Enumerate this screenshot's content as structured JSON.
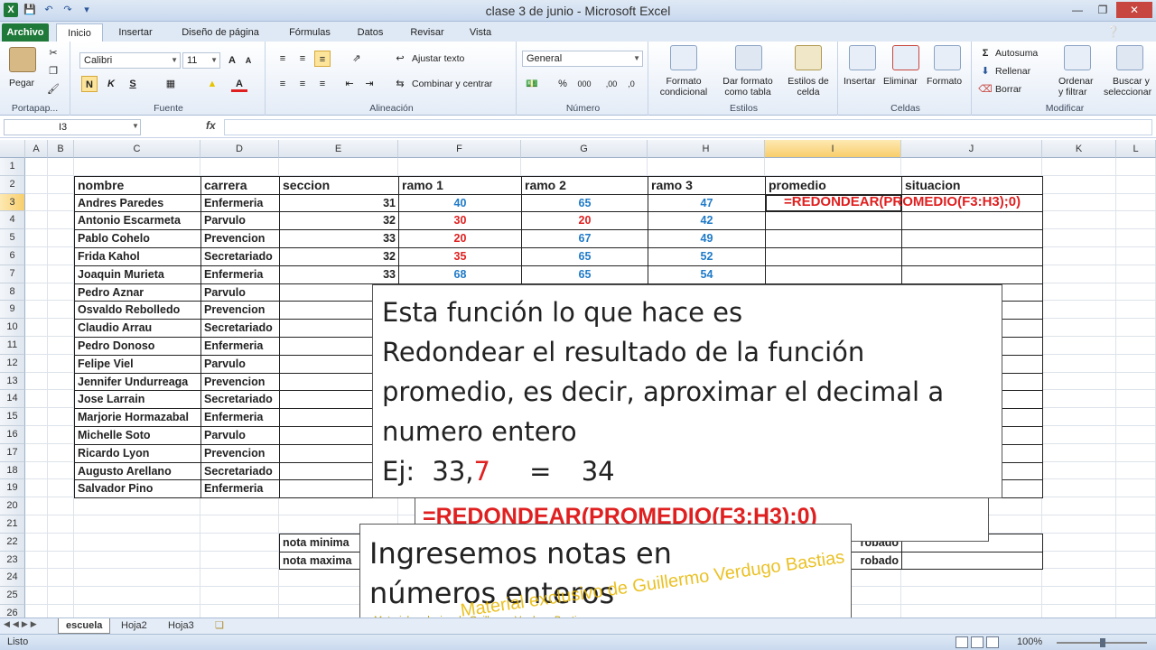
{
  "window": {
    "title": "clase 3 de junio - Microsoft Excel"
  },
  "qat": {
    "app_icon": "X",
    "save": "save-icon",
    "undo": "undo-icon",
    "redo": "redo-icon"
  },
  "tabs": [
    "Archivo",
    "Inicio",
    "Insertar",
    "Diseño de página",
    "Fórmulas",
    "Datos",
    "Revisar",
    "Vista"
  ],
  "ribbon": {
    "clipboard": {
      "label": "Portapap...",
      "paste": "Pegar"
    },
    "font": {
      "label": "Fuente",
      "font_name": "Calibri",
      "font_size": "11",
      "bold": "N",
      "italic": "K",
      "underline": "S",
      "grow": "A",
      "shrink": "A",
      "color": "A"
    },
    "alignment": {
      "label": "Alineación",
      "wrap": "Ajustar texto",
      "merge": "Combinar y centrar"
    },
    "number": {
      "label": "Número",
      "format": "General",
      "percent": "%",
      "thousands": "000",
      "inc_dec": ",00",
      "dec_dec": ",0"
    },
    "styles": {
      "label": "Estilos",
      "cond": "Formato",
      "cond2": "condicional",
      "table": "Dar formato",
      "table2": "como tabla",
      "cell": "Estilos de",
      "cell2": "celda"
    },
    "cells": {
      "label": "Celdas",
      "insert": "Insertar",
      "delete": "Eliminar",
      "format": "Formato"
    },
    "editing": {
      "label": "Modificar",
      "autosum": "Autosuma",
      "fill": "Rellenar",
      "clear": "Borrar",
      "sort": "Ordenar",
      "sort2": "y filtrar",
      "find": "Buscar y",
      "find2": "seleccionar"
    }
  },
  "formula_bar": {
    "name_box": "I3",
    "fx": "fx",
    "value": ""
  },
  "columns": [
    "A",
    "B",
    "C",
    "D",
    "E",
    "F",
    "G",
    "H",
    "I",
    "J",
    "K",
    "L"
  ],
  "rows": [
    "1",
    "2",
    "3",
    "4",
    "5",
    "6",
    "7",
    "8",
    "9",
    "10",
    "11",
    "12",
    "13",
    "14",
    "15",
    "16",
    "17",
    "18",
    "19",
    "20",
    "21",
    "22",
    "23",
    "24",
    "25",
    "26"
  ],
  "table": {
    "headers": [
      "nombre",
      "carrera",
      "seccion",
      "ramo 1",
      "ramo 2",
      "ramo 3",
      "promedio",
      "situacion"
    ],
    "records": [
      {
        "nombre": "Andres Paredes",
        "carrera": "Enfermeria",
        "seccion": "31",
        "r1": "40",
        "r2": "65",
        "r3": "47",
        "c1": "blue",
        "c2": "blue",
        "c3": "blue"
      },
      {
        "nombre": "Antonio Escarmeta",
        "carrera": "Parvulo",
        "seccion": "32",
        "r1": "30",
        "r2": "20",
        "r3": "42",
        "c1": "red",
        "c2": "red",
        "c3": "blue"
      },
      {
        "nombre": "Pablo Cohelo",
        "carrera": "Prevencion",
        "seccion": "33",
        "r1": "20",
        "r2": "67",
        "r3": "49",
        "c1": "red",
        "c2": "blue",
        "c3": "blue"
      },
      {
        "nombre": "Frida Kahol",
        "carrera": "Secretariado",
        "seccion": "32",
        "r1": "35",
        "r2": "65",
        "r3": "52",
        "c1": "red",
        "c2": "blue",
        "c3": "blue"
      },
      {
        "nombre": "Joaquin Murieta",
        "carrera": "Enfermeria",
        "seccion": "33",
        "r1": "68",
        "r2": "65",
        "r3": "54",
        "c1": "blue",
        "c2": "blue",
        "c3": "blue"
      },
      {
        "nombre": "Pedro Aznar",
        "carrera": "Parvulo"
      },
      {
        "nombre": "Osvaldo Rebolledo",
        "carrera": "Prevencion"
      },
      {
        "nombre": "Claudio Arrau",
        "carrera": "Secretariado"
      },
      {
        "nombre": "Pedro Donoso",
        "carrera": "Enfermeria"
      },
      {
        "nombre": "Felipe Viel",
        "carrera": "Parvulo"
      },
      {
        "nombre": "Jennifer Undurreaga",
        "carrera": "Prevencion"
      },
      {
        "nombre": "Jose Larrain",
        "carrera": "Secretariado"
      },
      {
        "nombre": "Marjorie Hormazabal",
        "carrera": "Enfermeria"
      },
      {
        "nombre": "Michelle Soto",
        "carrera": "Parvulo"
      },
      {
        "nombre": "Ricardo Lyon",
        "carrera": "Prevencion"
      },
      {
        "nombre": "Augusto Arellano",
        "carrera": "Secretariado"
      },
      {
        "nombre": "Salvador Pino",
        "carrera": "Enfermeria"
      }
    ],
    "nota_minima": "nota minima",
    "nota_maxima": "nota maxima",
    "aprobado_partial_1": "robado",
    "aprobado_partial_2": "robado"
  },
  "inline_formula": "=REDONDEAR(PROMEDIO(F3:H3);0)",
  "callout1": {
    "line1": "Esta función lo que hace es",
    "line2": "Redondear el resultado de la función",
    "line3": "promedio, es decir, aproximar el decimal a",
    "line4": "numero entero",
    "ej": "Ej:",
    "int_part": "33,",
    "dec_part": "7",
    "equals": "=",
    "result": "34"
  },
  "callout2": "=REDONDEAR(PROMEDIO(F3:H3);0)",
  "callout3": {
    "line1": "Ingresemos notas en",
    "line2": "números enteros"
  },
  "watermark": "Material exclusivo de Guillermo Verdugo Bastias",
  "watermark_small": "Material esclusivo de Guillermo Verdugo Bastias",
  "sheets": [
    "escuela",
    "Hoja2",
    "Hoja3"
  ],
  "status": {
    "ready": "Listo",
    "zoom": "100%"
  },
  "colors": {
    "file_tab": "#1f7a3a",
    "accent_red": "#e02020",
    "accent_blue": "#1f7ac8",
    "watermark": "#e7b700"
  }
}
